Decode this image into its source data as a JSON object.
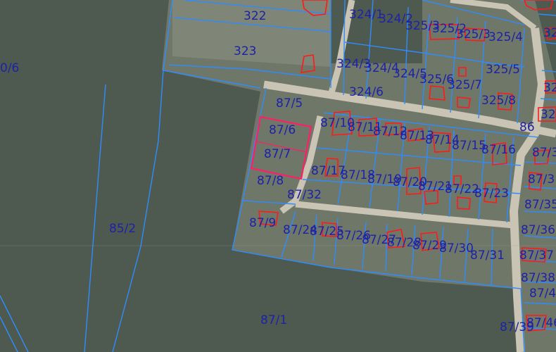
{
  "map": {
    "colors": {
      "forest": "#4e5a4f",
      "field": "#8a8f80",
      "road": "#c9c4b3",
      "boundary": "#2f8cff",
      "building": "#ff1a1a",
      "highlight": "#ff1f66",
      "label": "#1e22a6"
    },
    "parcel_labels": [
      "322",
      "323",
      "324/1",
      "324/2",
      "325/3",
      "325/2",
      "325/3",
      "325/4",
      "324/3",
      "324/4",
      "324/5",
      "325/6",
      "325/5",
      "324/6",
      "325/7",
      "325/8",
      "87/5",
      "87/6",
      "87/7",
      "87/8",
      "87/10",
      "87/11",
      "87/12",
      "87/13",
      "87/14",
      "87/15",
      "87/16",
      "87/17",
      "87/18",
      "87/19",
      "87/20",
      "87/21",
      "87/22",
      "87/23",
      "87/32",
      "87/9",
      "87/24",
      "87/25",
      "87/26",
      "87/27",
      "87/28",
      "87/29",
      "87/30",
      "87/31",
      "87/1",
      "87/39",
      "85/2",
      "86",
      "0/6",
      "87/3",
      "87/3",
      "87/35",
      "87/36",
      "87/37",
      "87/38",
      "87/4",
      "87/46",
      "32",
      "32",
      "32"
    ]
  }
}
